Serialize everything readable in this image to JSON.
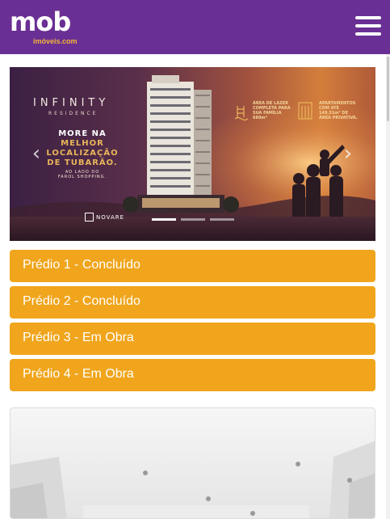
{
  "header": {
    "logo_text": "mob",
    "logo_subtext": "imóveis.com",
    "menu_icon": "hamburger-menu-icon",
    "background_color": "#6a2f94"
  },
  "carousel": {
    "brand_title": "INFINITY",
    "brand_subtitle": "RESIDENCE",
    "headline_line1": "MORE NA",
    "headline_line2": "MELHOR",
    "headline_line3": "LOCALIZAÇÃO",
    "headline_line4": "DE TUBARÃO.",
    "headline_sub1": "AO LADO DO",
    "headline_sub2": "FAROL SHOPPING.",
    "feature1_line1": "ÁREA DE LAZER",
    "feature1_line2": "COMPLETA PARA",
    "feature1_line3": "SUA FAMÍLIA",
    "feature1_line4": "680m²",
    "feature2_line1": "APARTAMENTOS",
    "feature2_line2": "COM ATÉ",
    "feature2_line3": "149,51m² DE",
    "feature2_line4": "ÁREA PRIVATIVA.",
    "developer": "NOVARE",
    "prev_icon": "chevron-left-icon",
    "next_icon": "chevron-right-icon",
    "slide_count": 3,
    "active_slide": 1
  },
  "buildings": [
    {
      "label": "Prédio 1 - Concluído"
    },
    {
      "label": "Prédio 2 - Concluído"
    },
    {
      "label": "Prédio 3 - Em Obra"
    },
    {
      "label": "Prédio 4 - Em Obra"
    }
  ],
  "colors": {
    "accent": "#f0a51c",
    "brand_purple": "#6a2f94",
    "logo_orange": "#f2b53a"
  }
}
